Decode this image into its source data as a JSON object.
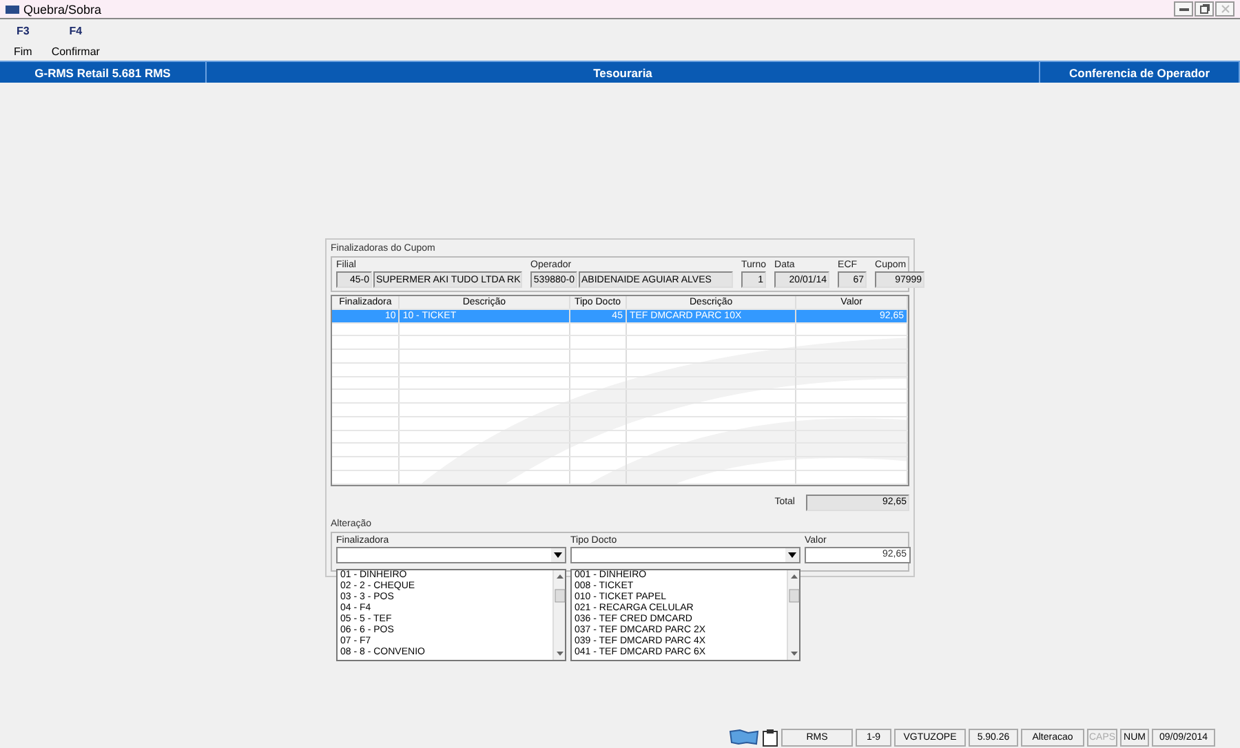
{
  "window": {
    "title": "Quebra/Sobra"
  },
  "toolbar": [
    {
      "key": "F3",
      "label": "Fim"
    },
    {
      "key": "F4",
      "label": "Confirmar"
    }
  ],
  "header_bar": [
    "G-RMS Retail 5.681 RMS",
    "Tesouraria",
    "Conferencia de Operador"
  ],
  "cupom": {
    "title": "Finalizadoras do Cupom",
    "filial": {
      "label": "Filial",
      "code": "45-0",
      "name": "SUPERMER AKI TUDO LTDA RK"
    },
    "operador": {
      "label": "Operador",
      "code": "539880-0",
      "name": "ABIDENAIDE AGUIAR ALVES"
    },
    "turno": {
      "label": "Turno",
      "value": "1"
    },
    "data": {
      "label": "Data",
      "value": "20/01/14"
    },
    "ecf": {
      "label": "ECF",
      "value": "67"
    },
    "cupom": {
      "label": "Cupom",
      "value": "97999"
    }
  },
  "table": {
    "columns": [
      "Finalizadora",
      "Descrição",
      "Tipo Docto",
      "Descrição",
      "Valor"
    ],
    "rows": [
      {
        "cells": [
          "10",
          "10 - TICKET",
          "45",
          "TEF DMCARD PARC 10X",
          "92,65"
        ],
        "selected": true
      }
    ]
  },
  "total": {
    "label": "Total",
    "value": "92,65"
  },
  "alteracao": {
    "title": "Alteração",
    "finalizadora": {
      "label": "Finalizadora",
      "options": [
        "01 - DINHEIRO",
        "02 - 2 - CHEQUE",
        "03 - 3 - POS",
        "04 - F4",
        "05 - 5 - TEF",
        "06 - 6 - POS",
        "07 - F7",
        "08 - 8 - CONVENIO"
      ]
    },
    "tipo_docto": {
      "label": "Tipo Docto",
      "options": [
        "001 - DINHEIRO",
        "008 - TICKET",
        "010 - TICKET PAPEL",
        "021 - RECARGA CELULAR",
        "036 - TEF CRED DMCARD",
        "037 - TEF DMCARD PARC 2X",
        "039 - TEF DMCARD PARC 4X",
        "041 - TEF DMCARD PARC 6X"
      ]
    },
    "valor": {
      "label": "Valor",
      "value": "92,65"
    }
  },
  "status_bar": [
    {
      "text": "RMS",
      "disabled": false
    },
    {
      "text": "1-9",
      "disabled": false
    },
    {
      "text": "VGTUZOPE",
      "disabled": false
    },
    {
      "text": "5.90.26",
      "disabled": false
    },
    {
      "text": "Alteracao",
      "disabled": false
    },
    {
      "text": "CAPS",
      "disabled": true
    },
    {
      "text": "NUM",
      "disabled": false
    },
    {
      "text": "09/09/2014",
      "disabled": false
    }
  ]
}
